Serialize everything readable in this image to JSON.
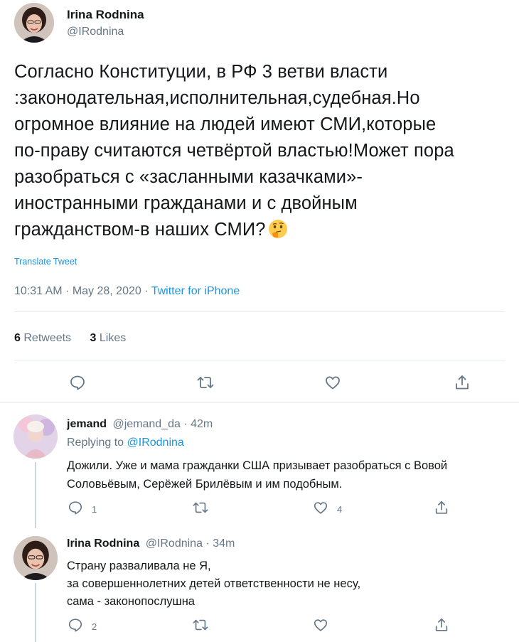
{
  "tweet": {
    "author_name": "Irina Rodnina",
    "author_handle": "@IRodnina",
    "text": "Согласно Конституции, в РФ 3 ветви власти\n:законодательная,исполнительная,судебная.Но\nогромное влияние на людей имеют СМИ,которые\nпо-праву считаются четвёртой властью!Может пора\nразобраться с «засланными казачками»-\nиностранными гражданами и с двойным\nгражданством-в наших СМИ?",
    "emoji": "thinking-face-icon",
    "translate_label": "Translate Tweet",
    "timestamp": "10:31 AM · May 28, 2020",
    "separator": " · ",
    "source": "Twitter for iPhone",
    "retweets_count": "6",
    "retweets_label": "Retweets",
    "likes_count": "3",
    "likes_label": "Likes"
  },
  "replies": [
    {
      "author_name": "jemand",
      "author_handle": "@jemand_da",
      "time": "· 42m",
      "replying_prefix": "Replying to",
      "replying_to": "@IRodnina",
      "text": "Дожили. Уже и мама гражданки США призывает разобраться с Вовой\nСоловьёвым, Серёжей Брилёвым и им подобным.",
      "reply_count": "1",
      "like_count": "4"
    },
    {
      "author_name": "Irina Rodnina",
      "author_handle": "@IRodnina",
      "time": "· 34m",
      "text": "Страну разваливала не Я,\nза совершеннолетних детей ответственности не несу,\nсама - законопослушна",
      "reply_count": "2"
    }
  ],
  "colors": {
    "accent": "#1b95e0",
    "muted": "#657786",
    "divider": "#e6ecf0"
  }
}
